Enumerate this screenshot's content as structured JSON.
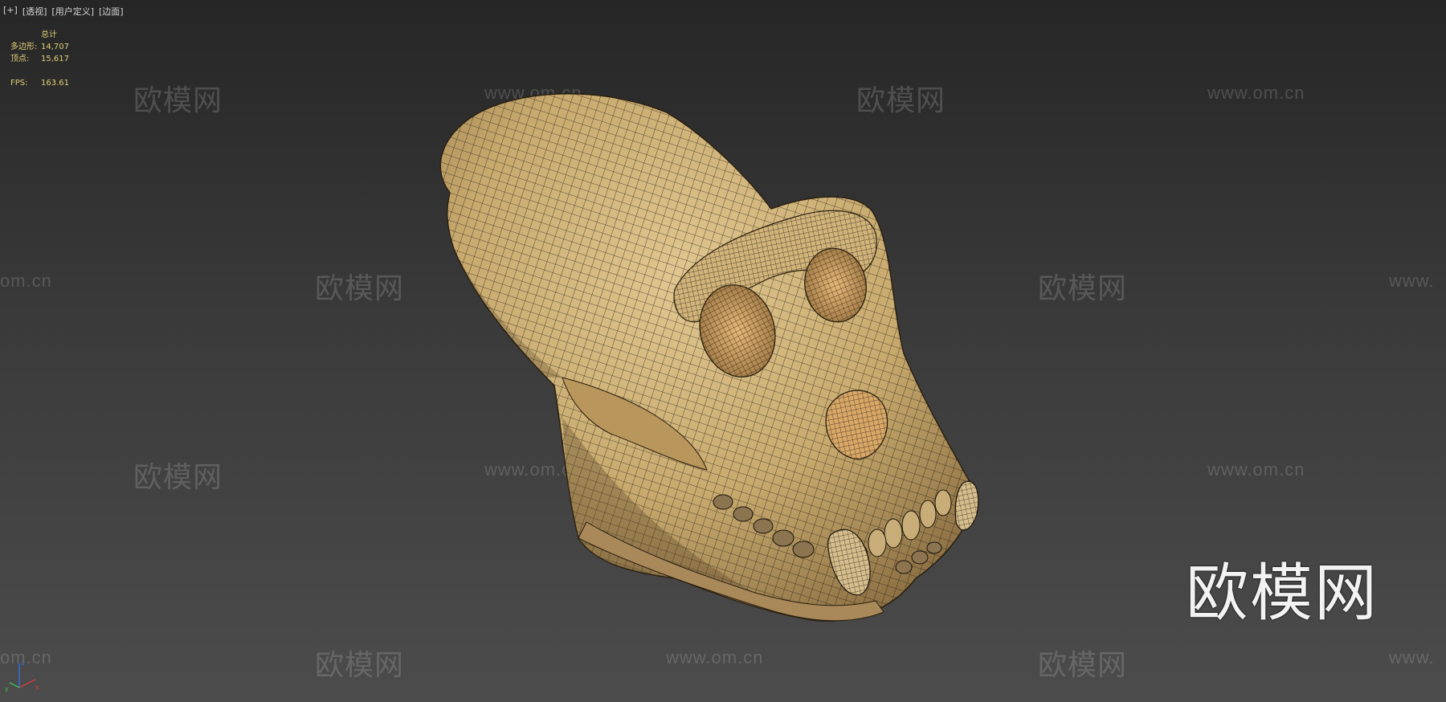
{
  "viewport": {
    "menu": [
      "[+]",
      "[透视]",
      "[用户定义]",
      "[边面]"
    ],
    "stats": {
      "header": "总计",
      "polygons_label": "多边形:",
      "polygons_value": "14,707",
      "vertices_label": "顶点:",
      "vertices_value": "15,617",
      "fps_label": "FPS:",
      "fps_value": "163.61"
    },
    "model_name": "gorilla-skull-wireframe",
    "colors": {
      "background_top": "#262626",
      "background_bottom": "#4c4c4c",
      "bone": "#c8aa6e",
      "wire": "#1a140c",
      "stats_text": "#e2cf78"
    }
  },
  "watermarks": {
    "brand": "欧模网",
    "url": "www.om.cn",
    "url_partial_left": "om.cn",
    "url_partial_right": "www.",
    "big": "欧模网"
  },
  "axis_gizmo": {
    "x": "x",
    "z": "z",
    "y": "y"
  }
}
